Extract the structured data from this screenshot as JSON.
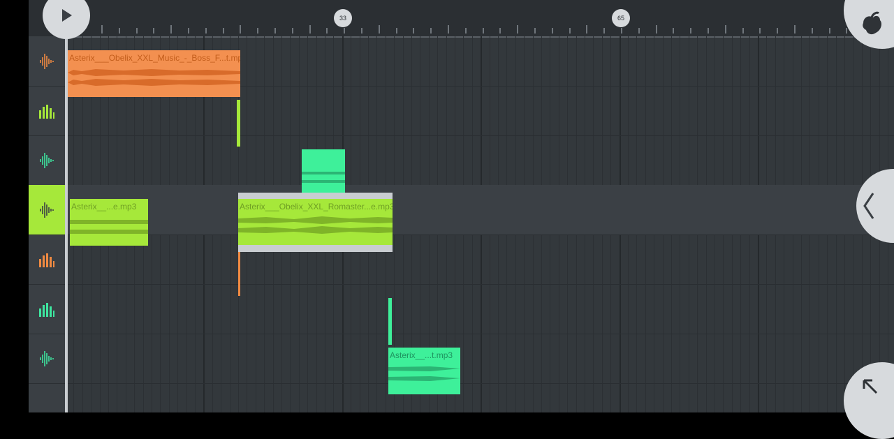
{
  "ruler": {
    "markers": [
      "33",
      "65"
    ]
  },
  "tracks": [
    {
      "icon": "audio-wave-icon",
      "color": "#f08a42",
      "selected": false
    },
    {
      "icon": "bars-icon",
      "color": "#a6e83a",
      "selected": false
    },
    {
      "icon": "audio-wave-icon",
      "color": "#3ee6a0",
      "selected": false
    },
    {
      "icon": "audio-wave-icon",
      "color": "#3a3f44",
      "selected": true
    },
    {
      "icon": "bars-icon",
      "color": "#f08a42",
      "selected": false
    },
    {
      "icon": "bars-icon",
      "color": "#3ee6a0",
      "selected": false
    },
    {
      "icon": "audio-wave-icon",
      "color": "#3ee6a0",
      "selected": false
    }
  ],
  "clips": {
    "boss": {
      "name": "Asterix___Obelix_XXL_Music_-_Boss_F...t.mp3",
      "color": "#f39050",
      "wave": "#d86b2a"
    },
    "romaster": {
      "name": "Asterix___Obelix_XXL_Romaster...e.mp3",
      "color": "#a6e83a",
      "wave": "#7fb428"
    },
    "small_green": {
      "name": "Asterix__...e.mp3",
      "color": "#a6e83a",
      "wave": "#7fb428"
    },
    "teal": {
      "name": "Asterix__...t.mp3",
      "color": "#3ef09a",
      "wave": "#2bb574"
    }
  },
  "colors": {
    "accent": "#a6e83a",
    "orange": "#f08a42",
    "teal": "#3ef09a"
  }
}
